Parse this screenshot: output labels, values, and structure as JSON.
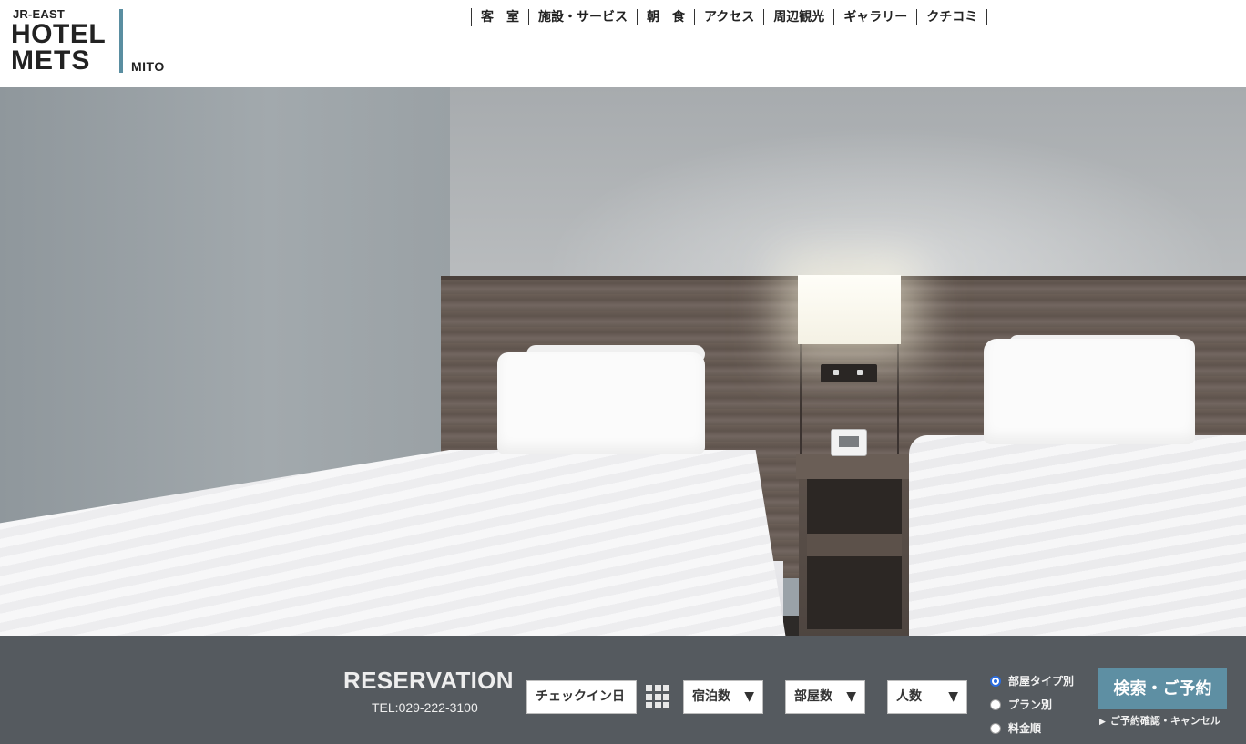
{
  "header": {
    "logo": {
      "brand": "JR-EAST",
      "line1": "HOTEL",
      "line2": "METS",
      "location": "MITO",
      "bar_color": "#5a8ea1"
    },
    "nav": [
      {
        "label": "客　室"
      },
      {
        "label": "施設・サービス"
      },
      {
        "label": "朝　食"
      },
      {
        "label": "アクセス"
      },
      {
        "label": "周辺観光"
      },
      {
        "label": "ギャラリー"
      },
      {
        "label": "クチコミ"
      }
    ]
  },
  "hero": {
    "image": "hotel-twin-room-photo"
  },
  "reservation": {
    "title": "RESERVATION",
    "tel": "TEL:029-222-3100",
    "checkin_label": "チェックイン日",
    "calendar_icon": "calendar-grid-icon",
    "nights": {
      "label": "宿泊数",
      "caret": "▼"
    },
    "rooms": {
      "label": "部屋数",
      "caret": "▼"
    },
    "people": {
      "label": "人数",
      "caret": "▼"
    },
    "sort_options": [
      {
        "label": "部屋タイプ別",
        "checked": true
      },
      {
        "label": "プラン別",
        "checked": false
      },
      {
        "label": "料金順",
        "checked": false
      }
    ],
    "search_button": "検索・ご予約",
    "confirm_cancel_link": "ご予約確認・キャンセル",
    "colors": {
      "bar_background": "#555a5f",
      "button": "#5e8fa3",
      "radio_accent": "#2b6de0"
    }
  }
}
